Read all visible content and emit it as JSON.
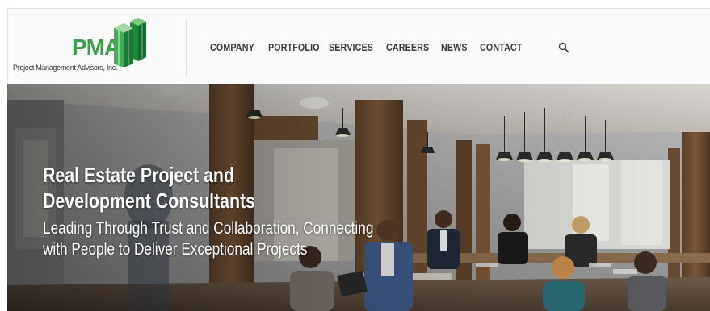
{
  "header": {
    "logo": {
      "letters": "PMA",
      "tagline": "Project Management Advisors, Inc.",
      "brand_color": "#3aa14a",
      "icon": "green-cube-columns-icon"
    },
    "nav": [
      {
        "label": "COMPANY"
      },
      {
        "label": "PORTFOLIO"
      },
      {
        "label": "SERVICES"
      },
      {
        "label": "CAREERS"
      },
      {
        "label": "NEWS"
      },
      {
        "label": "CONTACT"
      }
    ],
    "search_icon": "search-icon"
  },
  "hero": {
    "title_lines": [
      "Real Estate Project and",
      "Development Consultants"
    ],
    "subtitle_lines": [
      "Leading Through Trust and Collaboration, Connecting",
      "with People to Deliver Exceptional Projects"
    ]
  }
}
